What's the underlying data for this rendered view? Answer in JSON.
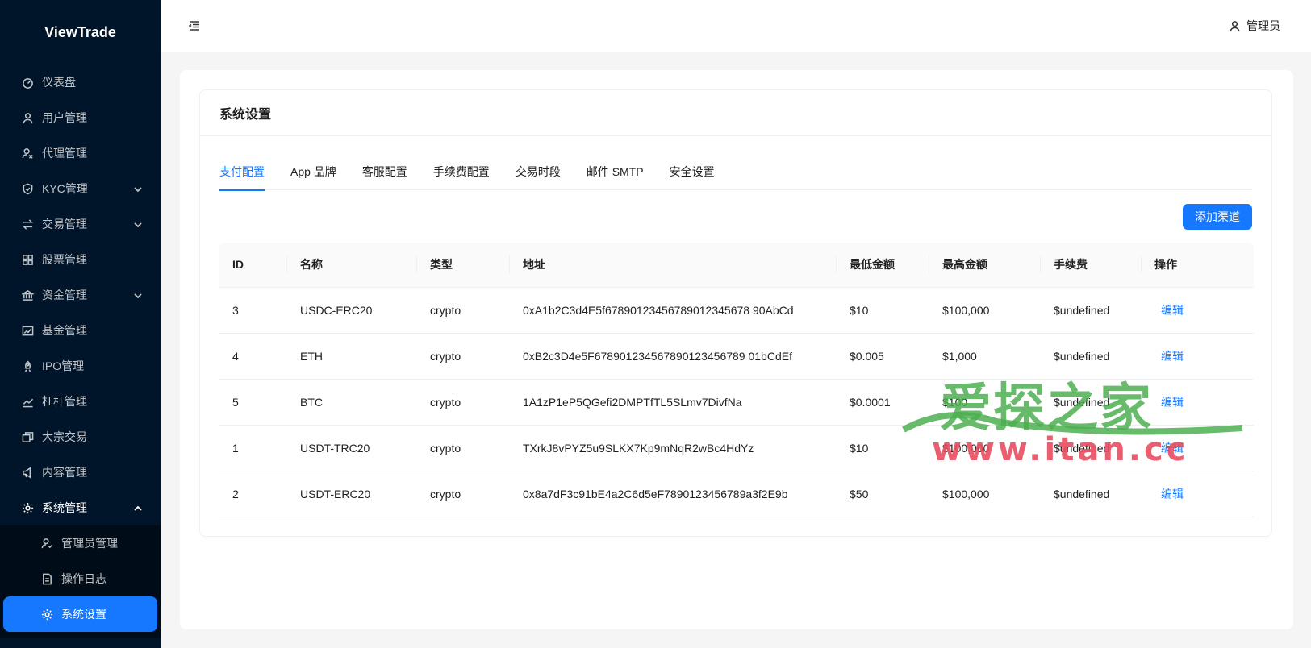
{
  "app": {
    "logo": "ViewTrade"
  },
  "header": {
    "user_label": "管理员"
  },
  "sidebar": {
    "items": [
      {
        "label": "仪表盘",
        "icon": "dashboard-icon"
      },
      {
        "label": "用户管理",
        "icon": "user-icon"
      },
      {
        "label": "代理管理",
        "icon": "agent-icon"
      },
      {
        "label": "KYC管理",
        "icon": "shield-icon",
        "expandable": true
      },
      {
        "label": "交易管理",
        "icon": "swap-icon",
        "expandable": true
      },
      {
        "label": "股票管理",
        "icon": "grid-icon"
      },
      {
        "label": "资金管理",
        "icon": "bank-icon",
        "expandable": true
      },
      {
        "label": "基金管理",
        "icon": "fund-chart-icon"
      },
      {
        "label": "IPO管理",
        "icon": "rocket-icon"
      },
      {
        "label": "杠杆管理",
        "icon": "line-chart-icon"
      },
      {
        "label": "大宗交易",
        "icon": "block-icon"
      },
      {
        "label": "内容管理",
        "icon": "notification-icon"
      },
      {
        "label": "系统管理",
        "icon": "setting-icon",
        "expandable": true,
        "open": true
      }
    ],
    "subitems": [
      {
        "label": "管理员管理",
        "icon": "admin-icon"
      },
      {
        "label": "操作日志",
        "icon": "file-icon"
      },
      {
        "label": "系统设置",
        "icon": "setting-icon",
        "selected": true
      }
    ]
  },
  "page": {
    "title": "系统设置",
    "tabs": [
      "支付配置",
      "App 品牌",
      "客服配置",
      "手续费配置",
      "交易时段",
      "邮件 SMTP",
      "安全设置"
    ],
    "active_tab": 0,
    "add_button": "添加渠道"
  },
  "table": {
    "columns": [
      "ID",
      "名称",
      "类型",
      "地址",
      "最低金额",
      "最高金额",
      "手续费",
      "操作"
    ],
    "rows": [
      {
        "id": "3",
        "name": "USDC-ERC20",
        "type": "crypto",
        "address": "0xA1b2C3d4E5f67890123456789012345678 90AbCd",
        "min": "$10",
        "max": "$100,000",
        "fee": "$undefined",
        "action": "编辑"
      },
      {
        "id": "4",
        "name": "ETH",
        "type": "crypto",
        "address": "0xB2c3D4e5F678901234567890123456789 01bCdEf",
        "min": "$0.005",
        "max": "$1,000",
        "fee": "$undefined",
        "action": "编辑"
      },
      {
        "id": "5",
        "name": "BTC",
        "type": "crypto",
        "address": "1A1zP1eP5QGefi2DMPTfTL5SLmv7DivfNa",
        "min": "$0.0001",
        "max": "$100",
        "fee": "$undefined",
        "action": "编辑"
      },
      {
        "id": "1",
        "name": "USDT-TRC20",
        "type": "crypto",
        "address": "TXrkJ8vPYZ5u9SLKX7Kp9mNqR2wBc4HdYz",
        "min": "$10",
        "max": "$100,000",
        "fee": "$undefined",
        "action": "编辑"
      },
      {
        "id": "2",
        "name": "USDT-ERC20",
        "type": "crypto",
        "address": "0x8a7dF3c91bE4a2C6d5eF7890123456789a3f2E9b",
        "min": "$50",
        "max": "$100,000",
        "fee": "$undefined",
        "action": "编辑"
      }
    ]
  },
  "watermark": {
    "top": "爱探之家",
    "bottom": "www.itan.cc"
  },
  "colors": {
    "primary": "#1677ff",
    "sidebar_bg": "#001529",
    "submenu_bg": "#000c17"
  }
}
